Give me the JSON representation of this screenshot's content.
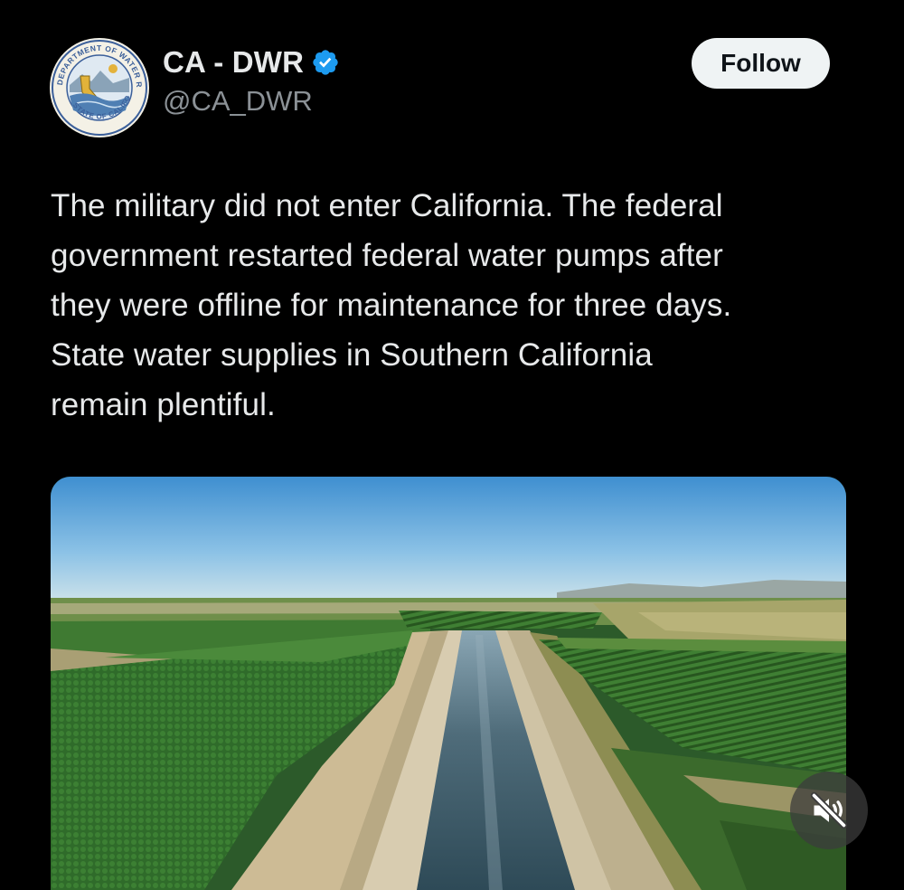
{
  "author": {
    "display_name": "CA - DWR",
    "handle": "@CA_DWR",
    "verified": true,
    "verified_color": "#1d9bf0",
    "avatar_icon": "department-of-water-resources-seal-icon",
    "avatar_seal_text_top": "DEPARTMENT OF WATER RESOURCES",
    "avatar_seal_text_bottom": "STATE OF CALIFORNIA"
  },
  "follow_button": {
    "label": "Follow"
  },
  "tweet": {
    "text": "The military did not enter California. The federal\ngovernment restarted federal water pumps after\nthey were offline for maintenance for three days.\nState water supplies in Southern California\nremain plentiful."
  },
  "media": {
    "type": "video",
    "subject": "aerial view of aqueduct canal between orchards",
    "mute_icon": "speaker-muted-icon"
  },
  "colors": {
    "background": "#000000",
    "text_primary": "#e7e9ea",
    "text_secondary": "#8b9196",
    "follow_bg": "#eff3f4",
    "follow_text": "#0f1419"
  }
}
